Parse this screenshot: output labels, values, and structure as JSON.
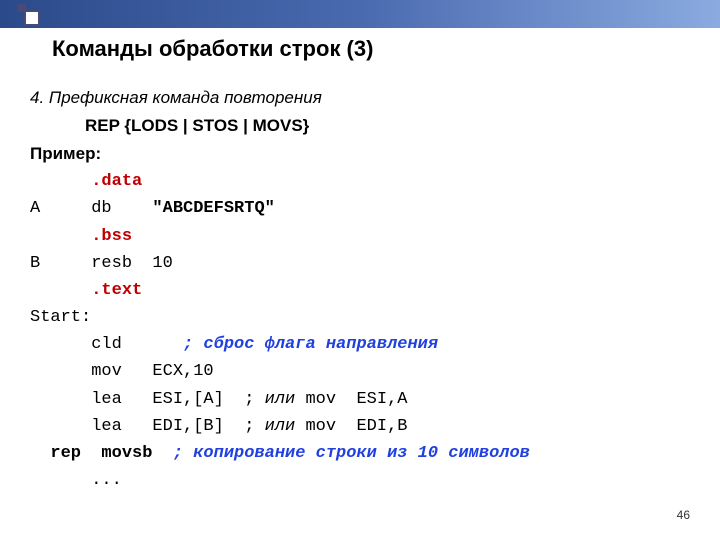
{
  "title": "Команды обработки строк (3)",
  "intro": "4. Префиксная команда повторения",
  "syntax": "REP    {LODS | STOS | MOVS}",
  "example_label": "Пример:",
  "code": {
    "l1": "      .data",
    "l2a": "A     db    ",
    "l2b": "\"ABCDEFSRTQ\"",
    "l3": "      .bss",
    "l4": "B     resb  10",
    "l5": "      .text",
    "l6": "Start:",
    "l7a": "      cld      ",
    "l7b": "; сброс флага направления",
    "l8": "      mov   ECX,10",
    "l9a": "      lea   ESI,[A]  ; ",
    "l9b": "или ",
    "l9c": "mov  ESI,A",
    "l10a": "      lea   EDI,[B]  ; ",
    "l10b": "или ",
    "l10c": "mov  EDI,B",
    "l11a": "  rep  movsb  ",
    "l11b": "; копирование строки из 10 символов",
    "l12": "      ..."
  },
  "slide_number": "46"
}
